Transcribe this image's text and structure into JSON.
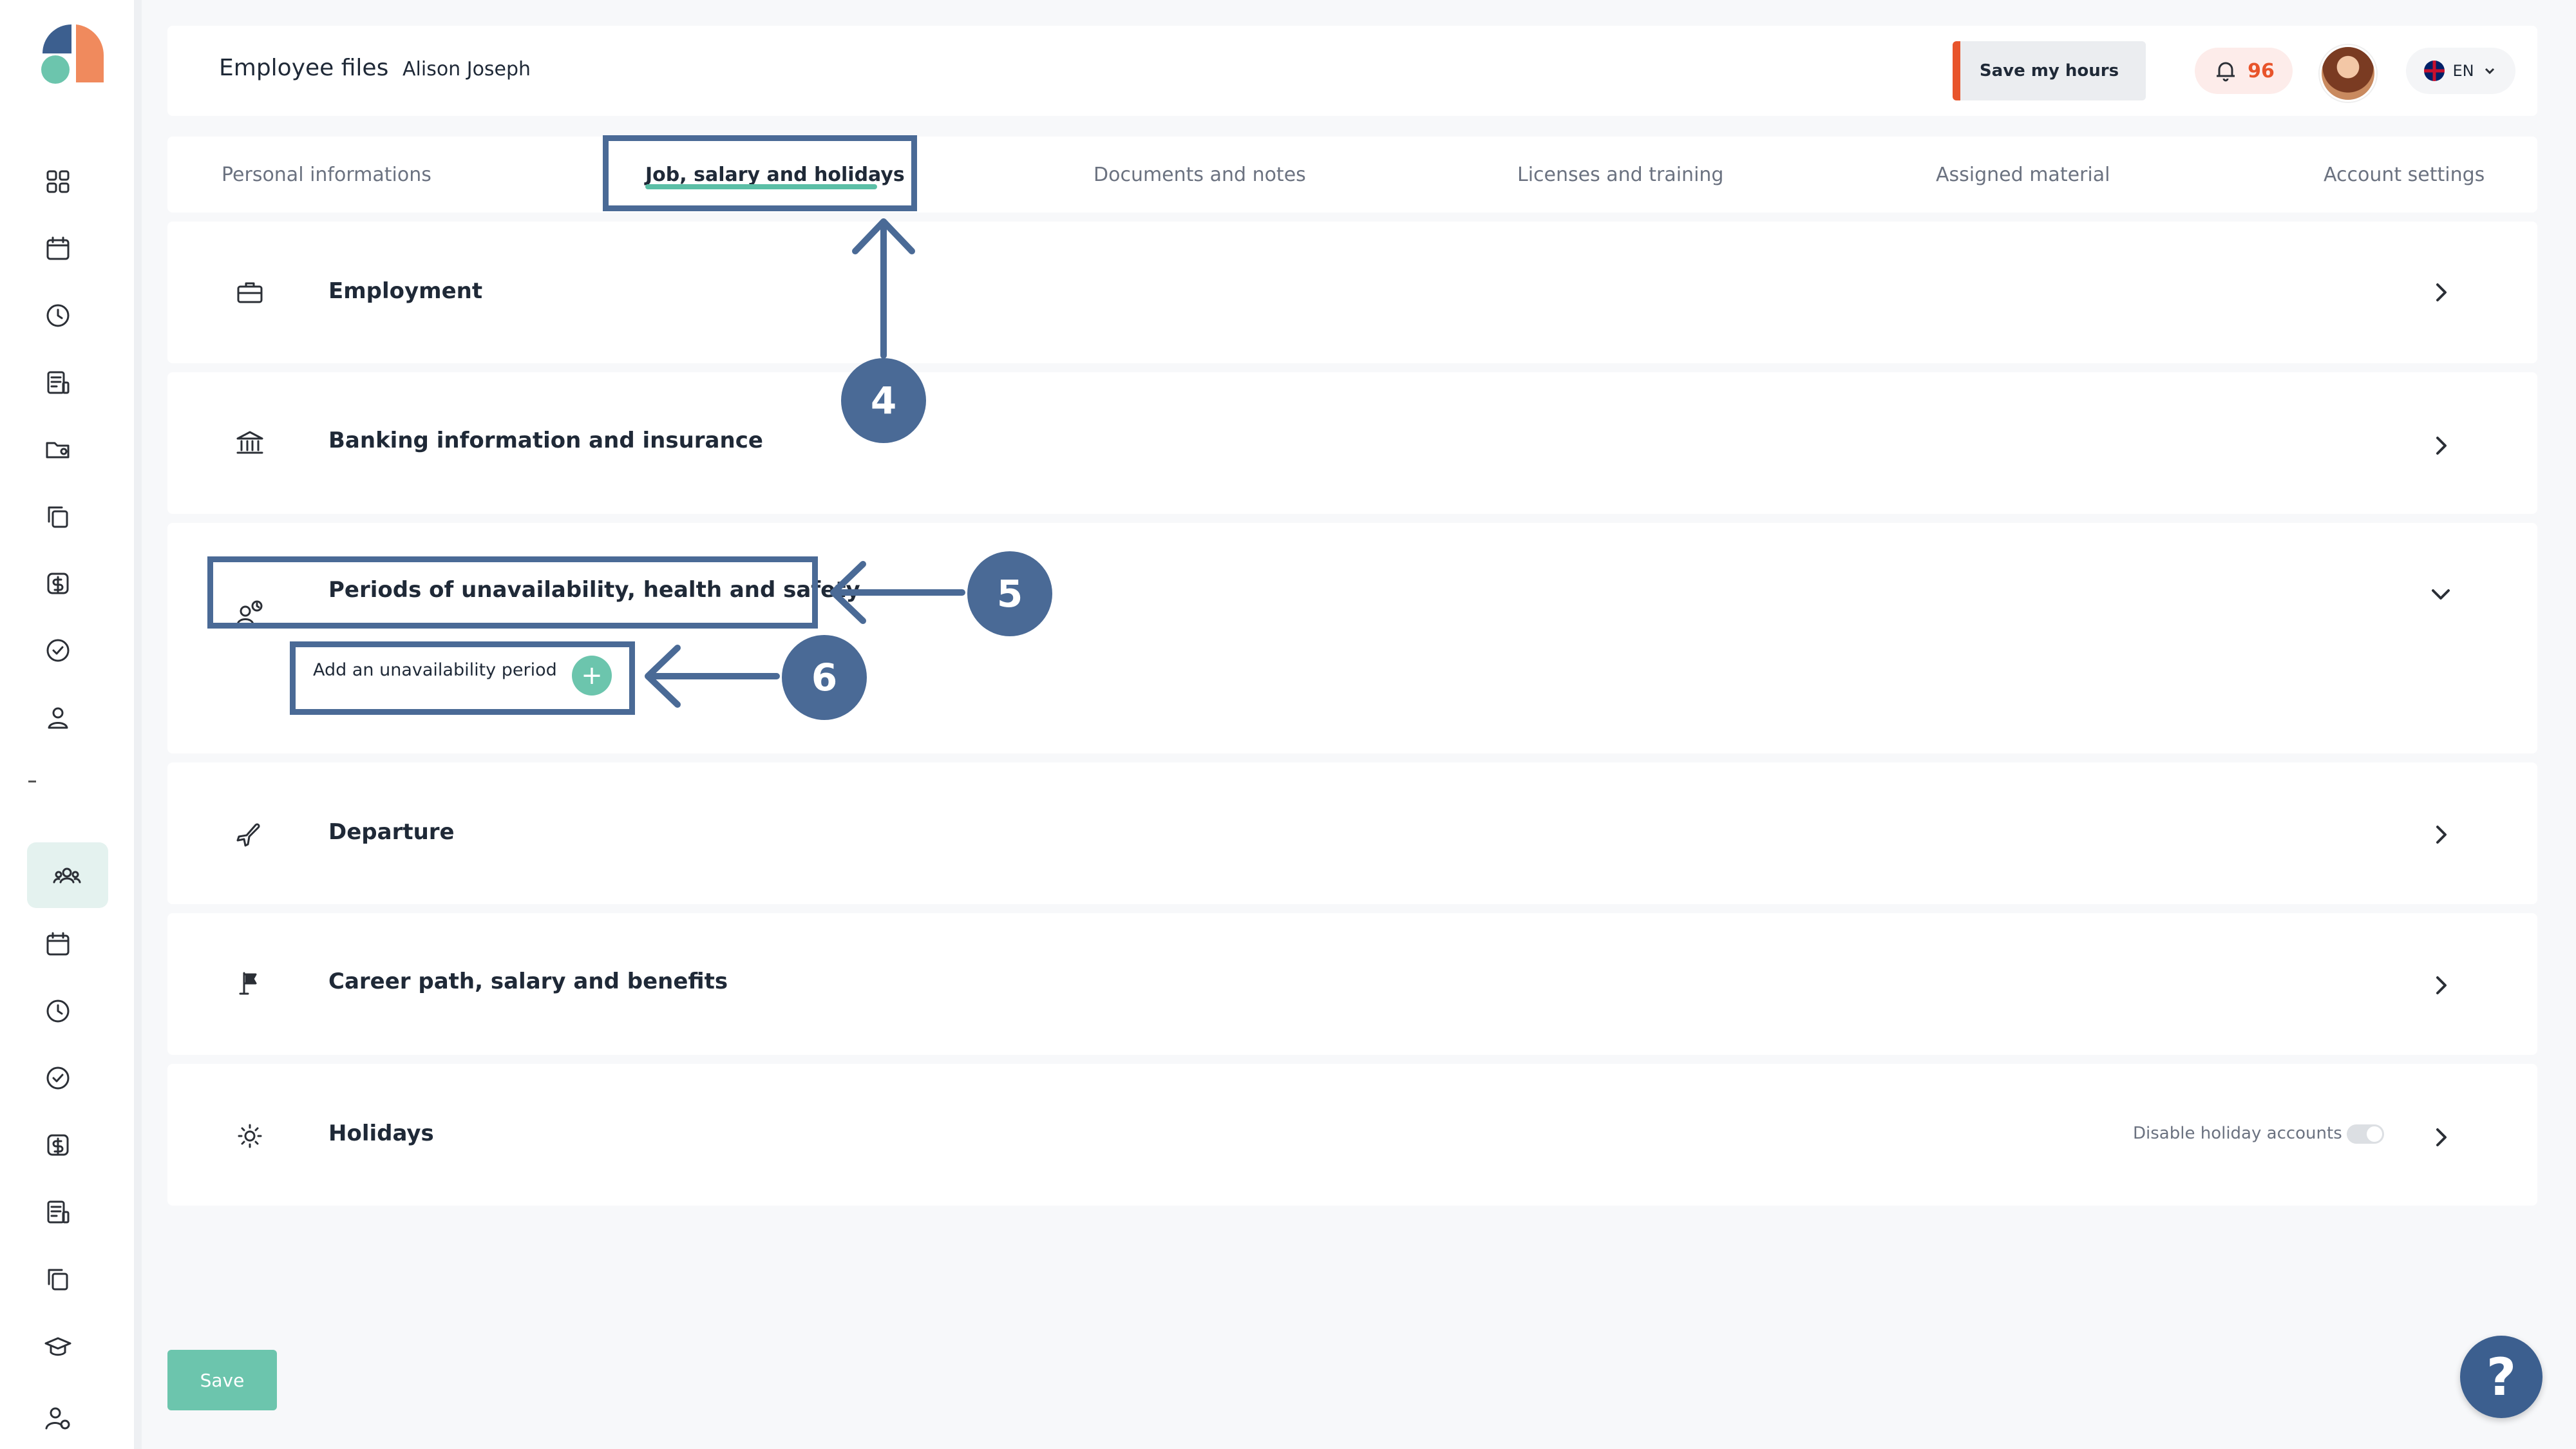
{
  "header": {
    "page_title": "Employee files",
    "employee_name": "Alison Joseph",
    "save_hours_label": "Save my hours",
    "notification_count": "96",
    "language": "EN"
  },
  "tabs": [
    {
      "label": "Personal informations",
      "active": false
    },
    {
      "label": "Job, salary and holidays",
      "active": true
    },
    {
      "label": "Documents and notes",
      "active": false
    },
    {
      "label": "Licenses and training",
      "active": false
    },
    {
      "label": "Assigned material",
      "active": false
    },
    {
      "label": "Account settings",
      "active": false
    }
  ],
  "sections": [
    {
      "title": "Employment",
      "icon": "briefcase-icon",
      "state": "collapsed"
    },
    {
      "title": "Banking information and insurance",
      "icon": "bank-icon",
      "state": "collapsed"
    },
    {
      "title": "Periods of unavailability, health and safety",
      "icon": "person-clock-icon",
      "state": "expanded",
      "action_label": "Add an unavailability period"
    },
    {
      "title": "Departure",
      "icon": "airplane-icon",
      "state": "collapsed"
    },
    {
      "title": "Career path, salary and benefits",
      "icon": "flag-icon",
      "state": "collapsed"
    },
    {
      "title": "Holidays",
      "icon": "sun-icon",
      "state": "collapsed",
      "toggle_label": "Disable holiday accounts",
      "toggle_on": false
    }
  ],
  "footer": {
    "save_label": "Save",
    "help_label": "?"
  },
  "annotations": [
    {
      "number": "4"
    },
    {
      "number": "5"
    },
    {
      "number": "6"
    }
  ],
  "colors": {
    "accent": "#6cc5ad",
    "annotation": "#4a6a96",
    "alert": "#e8542b",
    "background": "#f7f8fa"
  }
}
